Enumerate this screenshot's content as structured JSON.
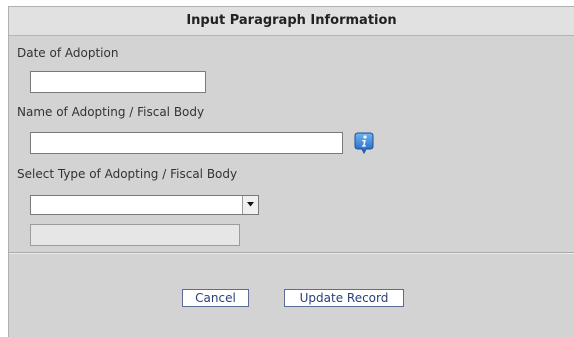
{
  "dialog": {
    "title": "Input Paragraph Information"
  },
  "form": {
    "date_label": "Date of Adoption",
    "date_value": "",
    "body_name_label": "Name of Adopting / Fiscal Body",
    "body_name_value": "",
    "type_label": "Select Type of Adopting / Fiscal Body",
    "type_selected": "",
    "type_other_value": ""
  },
  "icons": {
    "info": "info-icon",
    "dropdown": "chevron-down-icon"
  },
  "buttons": {
    "cancel_label": "Cancel",
    "update_label": "Update Record"
  },
  "colors": {
    "panel_background": "#d3d3d3",
    "title_background": "#e1e1e1",
    "info_icon_blue": "#2f7fd6",
    "button_text": "#2a3f7a"
  }
}
